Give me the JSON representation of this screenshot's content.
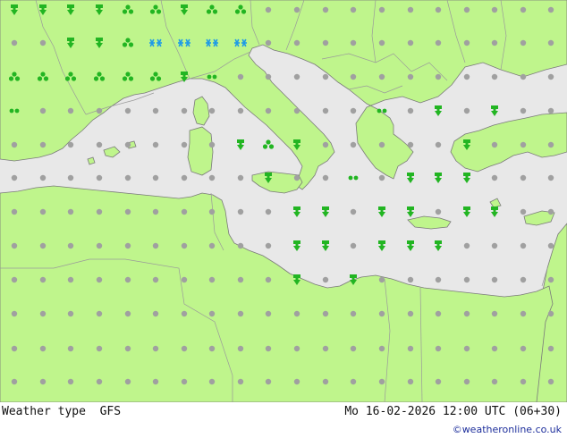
{
  "title": "Weather type",
  "model": "GFS",
  "valid_time": "Mo 16-02-2026 12:00 UTC (06+30)",
  "credit": "©weatheronline.co.uk",
  "colors": {
    "land": "#bff58c",
    "sea": "#e8e8e8",
    "border": "#9a9a9a",
    "coast": "#7a7a7a",
    "dry_symbol": "#a0a0a0",
    "rain_symbol": "#22b522",
    "snow_symbol": "#1f9be6"
  },
  "legend_symbols": {
    "dry": "circle",
    "rain": "raindrop-arrow-icon",
    "showers": "cloud-cluster-icon",
    "drizzle": "double-dot-icon",
    "snow": "snowflake-icon"
  }
}
